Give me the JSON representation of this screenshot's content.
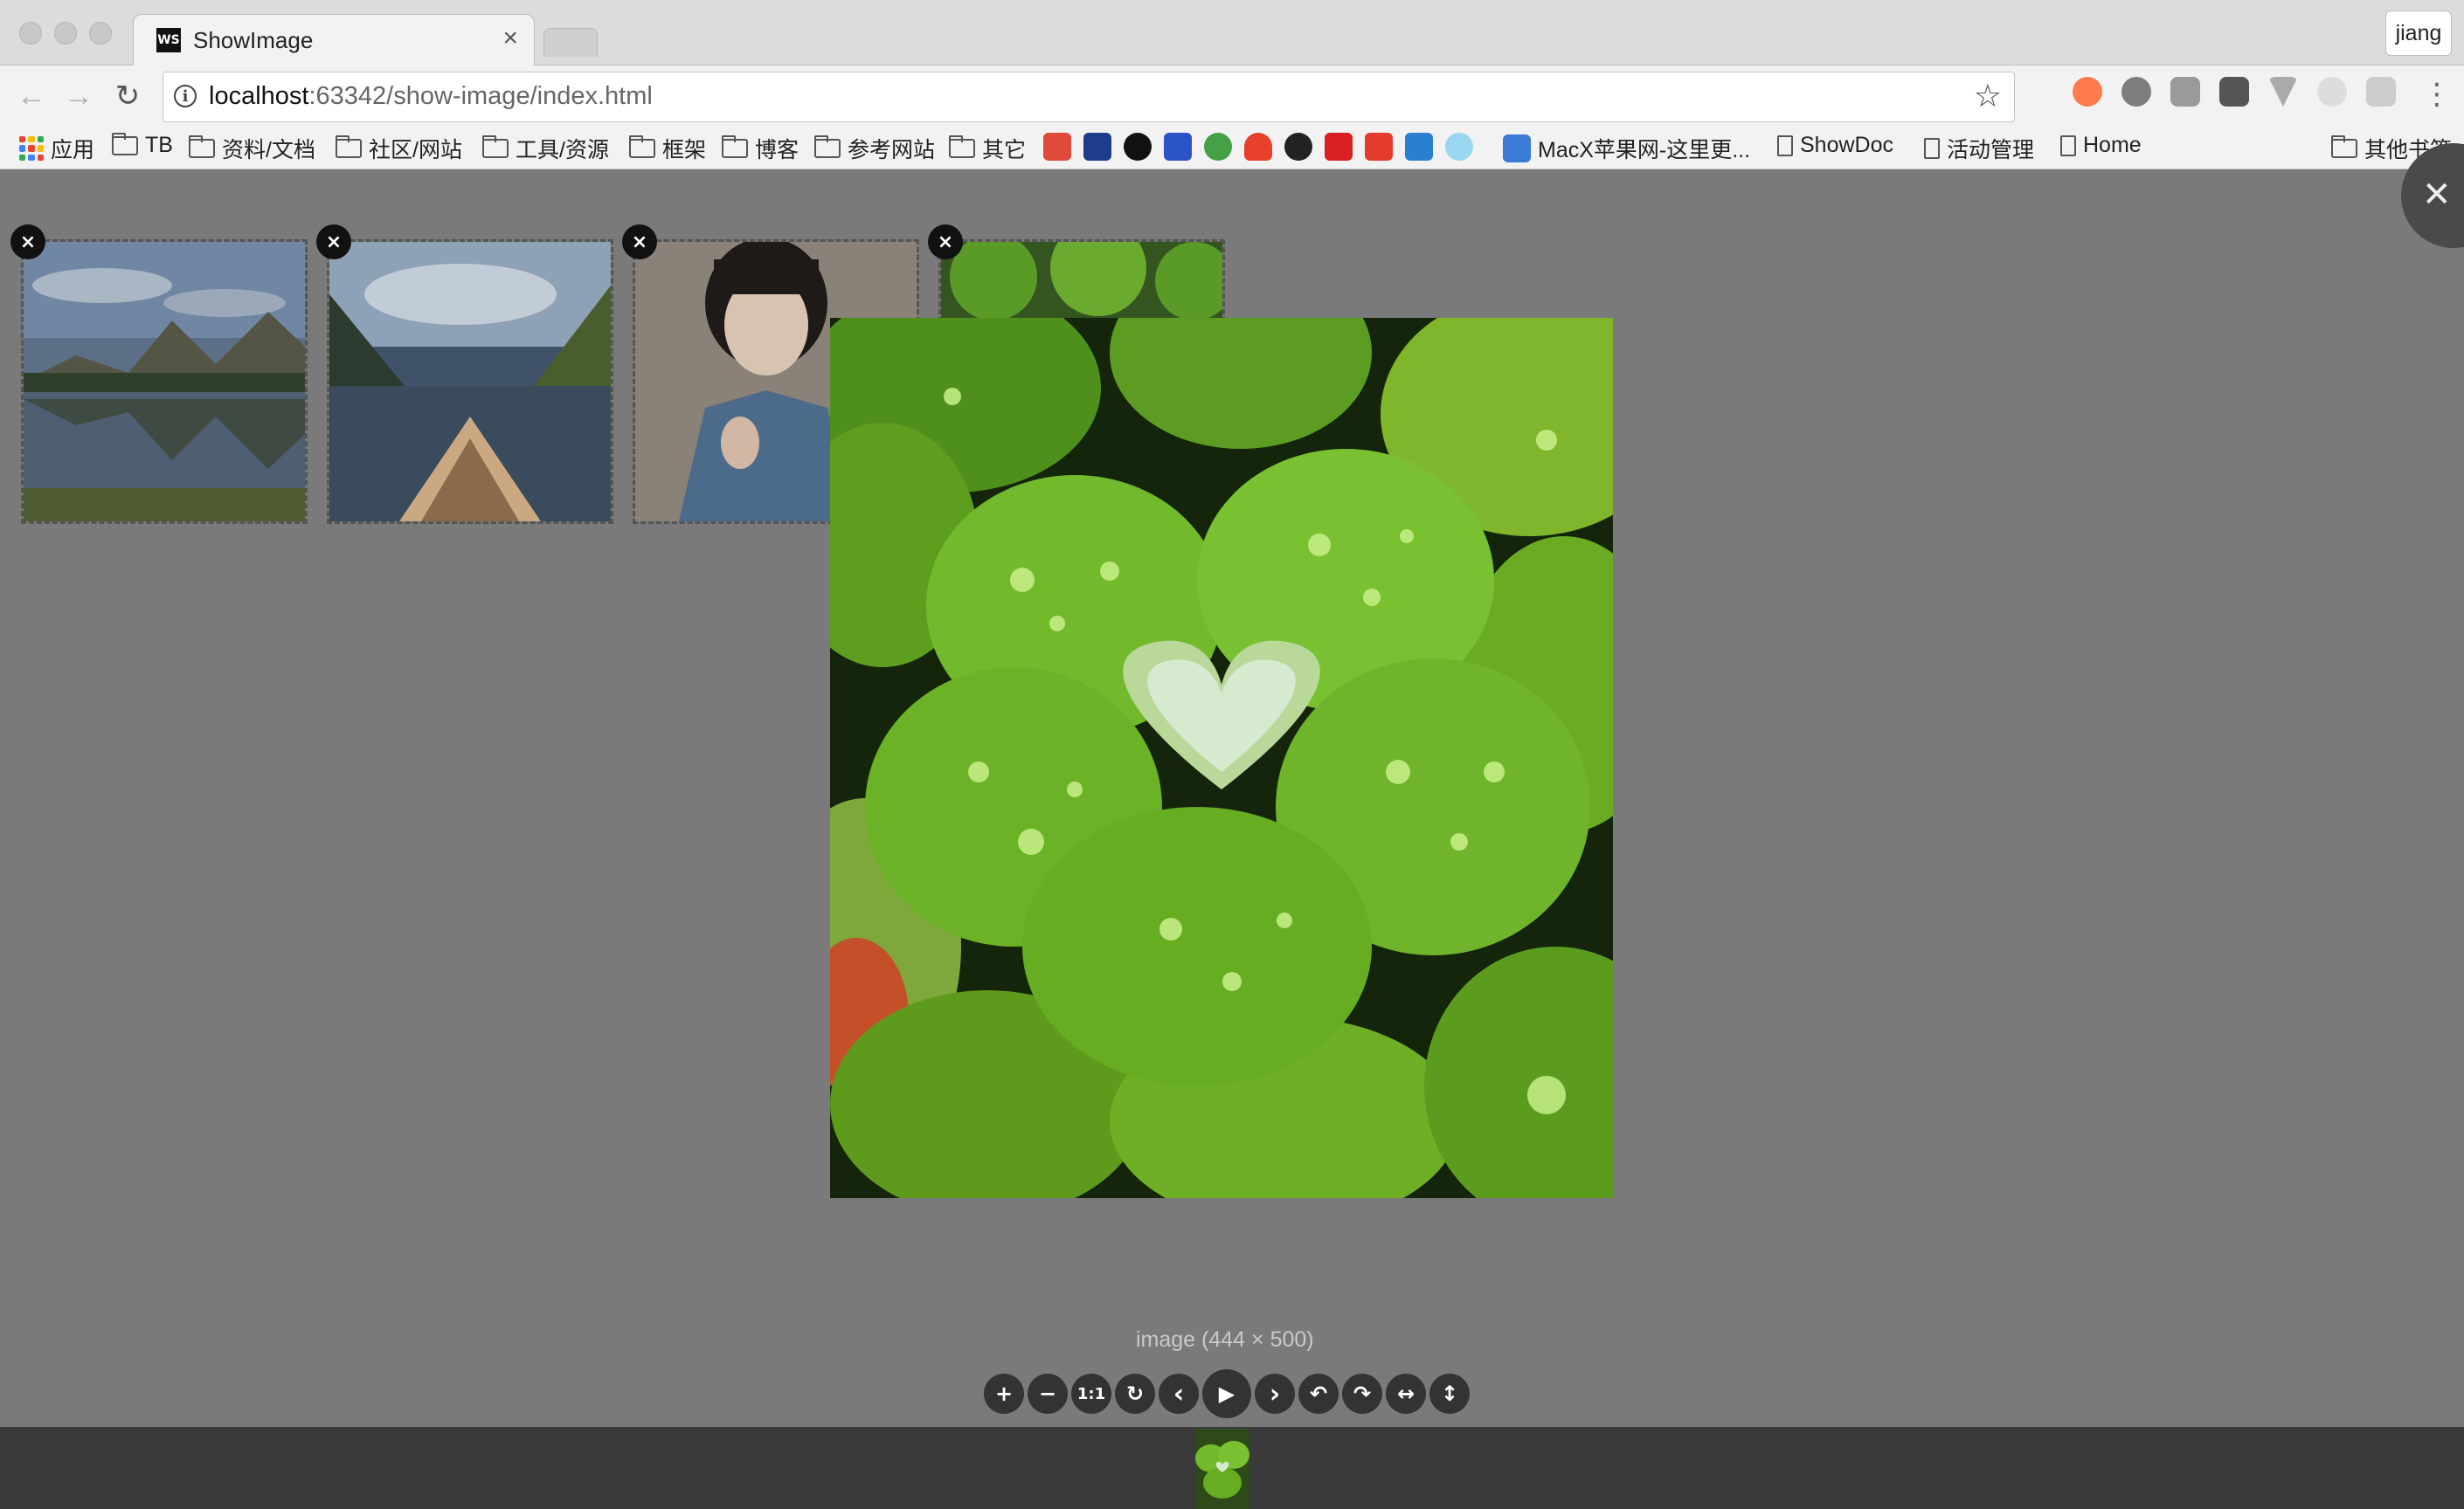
{
  "browser": {
    "tab_title": "ShowImage",
    "tab_favicon": "WS",
    "profile_name": "jiang",
    "url_host": "localhost",
    "url_rest": ":63342/show-image/index.html",
    "bookmarks": [
      "应用",
      "TB",
      "资料/文档",
      "社区/网站",
      "工具/资源",
      "框架",
      "博客",
      "参考网站",
      "其它",
      "MacX苹果网-这里更...",
      "ShowDoc",
      "活动管理",
      "Home",
      "其他书签"
    ]
  },
  "icons": {
    "back": "arrow-left-icon",
    "forward": "arrow-right-icon",
    "reload": "reload-icon",
    "info": "info-icon",
    "bookmark_star": "star-icon",
    "menu": "kebab-menu-icon",
    "remove": "close-icon",
    "viewer_close": "close-icon"
  },
  "viewer": {
    "caption": "image (444 × 500)",
    "controls": [
      {
        "name": "zoom-in",
        "glyph": "+"
      },
      {
        "name": "zoom-out",
        "glyph": "−"
      },
      {
        "name": "one-to-one",
        "glyph": "1:1"
      },
      {
        "name": "reset",
        "glyph": "↻"
      },
      {
        "name": "prev",
        "glyph": "‹"
      },
      {
        "name": "play",
        "glyph": "▶"
      },
      {
        "name": "next",
        "glyph": "›"
      },
      {
        "name": "rotate-left",
        "glyph": "↶"
      },
      {
        "name": "rotate-right",
        "glyph": "↷"
      },
      {
        "name": "flip-horizontal",
        "glyph": "↔"
      },
      {
        "name": "flip-vertical",
        "glyph": "↕"
      }
    ]
  },
  "thumbnails": [
    {
      "name": "thumbnail-mountain-lake"
    },
    {
      "name": "thumbnail-canoe-lake"
    },
    {
      "name": "thumbnail-portrait"
    },
    {
      "name": "thumbnail-clover"
    }
  ],
  "colors": {
    "overlay": "#7a7a7a",
    "strip": "#3a3a3a",
    "control_button": "#333333",
    "clover_green": "#6fbf2a"
  }
}
